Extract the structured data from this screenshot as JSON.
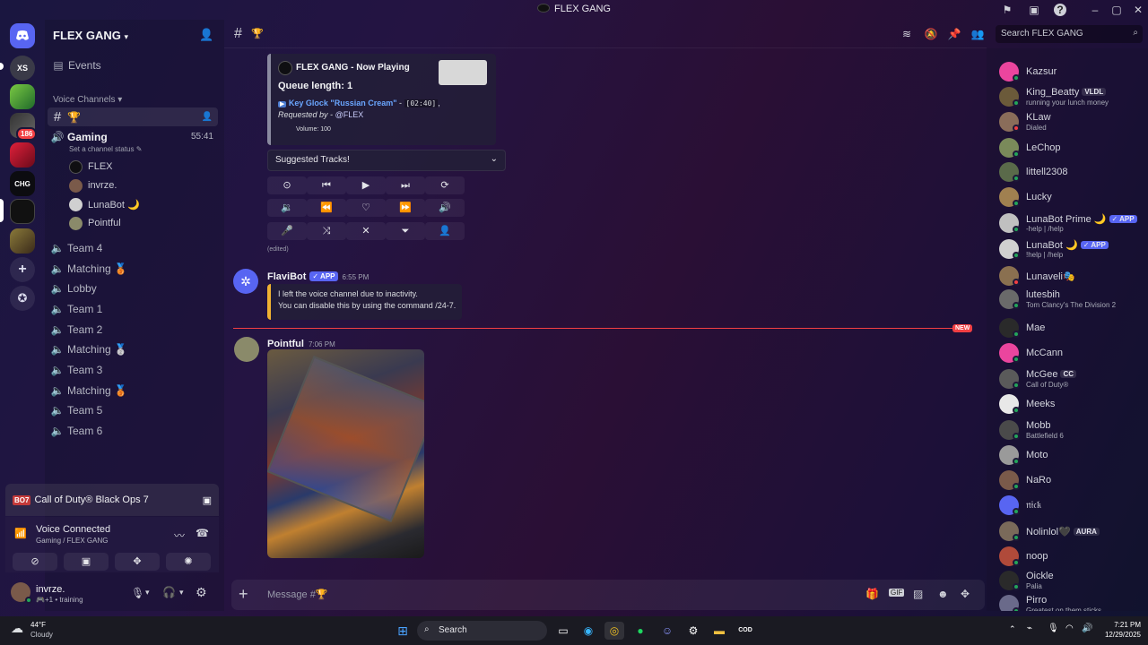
{
  "window": {
    "title": "FLEX GANG"
  },
  "rail": {
    "xs_label": "XS",
    "chg_label": "CHG",
    "badge": "186"
  },
  "sidebar": {
    "server_name": "FLEX GANG",
    "events": "Events",
    "voice_header": "Voice Channels",
    "top_channel": "🏆",
    "gaming": {
      "name": "Gaming",
      "time": "55:41",
      "status": "Set a channel status",
      "users": [
        "FLEX",
        "invrze.",
        "LunaBot 🌙",
        "Pointful"
      ]
    },
    "channels": [
      "Team 4",
      "Matching 🥉",
      "Lobby",
      "Team 1",
      "Team 2",
      "Matching 🥈",
      "Team 3",
      "Matching 🥉",
      "Team 5",
      "Team 6"
    ]
  },
  "game": {
    "logo": "BO7",
    "name": "Call of Duty® Black Ops 7"
  },
  "voice": {
    "title": "Voice Connected",
    "sub": "Gaming / FLEX GANG"
  },
  "user": {
    "name": "invrze.",
    "status": "+1 • training"
  },
  "header": {
    "channel": "🏆",
    "search_placeholder": "Search FLEX GANG"
  },
  "now_playing": {
    "title": "FLEX GANG - Now Playing",
    "queue": "Queue length: 1",
    "track": "Key Glock \"Russian Cream\"",
    "duration": "[02:40]",
    "requested_prefix": "Requested by -",
    "requested_user": "@FLEX",
    "volume": "Volume: 100",
    "suggested": "Suggested Tracks!",
    "edited": "(edited)"
  },
  "messages": [
    {
      "author": "FlaviBot",
      "tag": "APP",
      "time": "6:55 PM",
      "line1": "I left the voice channel due to inactivity.",
      "line2": "You can disable this by using the command /24-7."
    },
    {
      "author": "Pointful",
      "time": "7:06 PM"
    }
  ],
  "new_label": "NEW",
  "composer": {
    "placeholder": "Message #🏆"
  },
  "members": [
    {
      "name": "Kazsur",
      "color": "#eb459e",
      "status": "online"
    },
    {
      "name": "King_Beatty",
      "tag": "VLDL",
      "sub": "running your lunch money",
      "color": "#6b5a3a",
      "status": "online"
    },
    {
      "name": "KLaw",
      "sub": "Dialed",
      "color": "#8a6d5a",
      "status": "dnd"
    },
    {
      "name": "LeChop",
      "color": "#7a8a5a",
      "status": "online"
    },
    {
      "name": "littell2308",
      "color": "#5a6a4a",
      "status": "online"
    },
    {
      "name": "Lucky",
      "color": "#a08050",
      "status": "online"
    },
    {
      "name": "LunaBot Prime 🌙",
      "tag": "APP",
      "sub": "-help | /help",
      "color": "#c0c0c0",
      "status": "online"
    },
    {
      "name": "LunaBot 🌙",
      "tag": "APP",
      "sub": "!help | /help",
      "color": "#d0d0d0",
      "status": "online"
    },
    {
      "name": "Lunaveli🎭",
      "color": "#8a7050",
      "status": "dnd"
    },
    {
      "name": "lutesbih",
      "sub": "Tom Clancy's The Division 2",
      "color": "#6a6a6a",
      "status": "online"
    },
    {
      "name": "Mae",
      "color": "#2a2a2a",
      "status": "online"
    },
    {
      "name": "McCann",
      "color": "#eb459e",
      "status": "online"
    },
    {
      "name": "McGee",
      "tag": "CC",
      "sub": "Call of Duty®",
      "color": "#5a5a5a",
      "status": "online"
    },
    {
      "name": "Meeks",
      "color": "#e8e8e8",
      "status": "online"
    },
    {
      "name": "Mobb",
      "sub": "Battlefield 6",
      "color": "#4a4a4a",
      "status": "online"
    },
    {
      "name": "Moto",
      "color": "#9a9a9a",
      "status": "online"
    },
    {
      "name": "NaRo",
      "color": "#7a5a4a",
      "status": "online"
    },
    {
      "name": "𝔫𝔦𝔠𝔨",
      "color": "#5865f2",
      "status": "online"
    },
    {
      "name": "Nolinlol🖤",
      "tag": "AURA",
      "color": "#7a6a5a",
      "status": "online"
    },
    {
      "name": "noop",
      "color": "#b04a3a",
      "status": "online"
    },
    {
      "name": "Oickle",
      "sub": "Palia",
      "color": "#2a2a2a",
      "status": "online"
    },
    {
      "name": "Pirro",
      "sub": "Greatest on them sticks",
      "color": "#6a6a8a",
      "status": "online"
    }
  ],
  "taskbar": {
    "temp": "44°F",
    "weather": "Cloudy",
    "search": "Search",
    "time": "7:21 PM",
    "date": "12/29/2025"
  },
  "colors": {
    "accent": "#5865f2",
    "online": "#23a55a",
    "dnd": "#f23f43",
    "new": "#f23f43",
    "gold": "#f0b232"
  }
}
